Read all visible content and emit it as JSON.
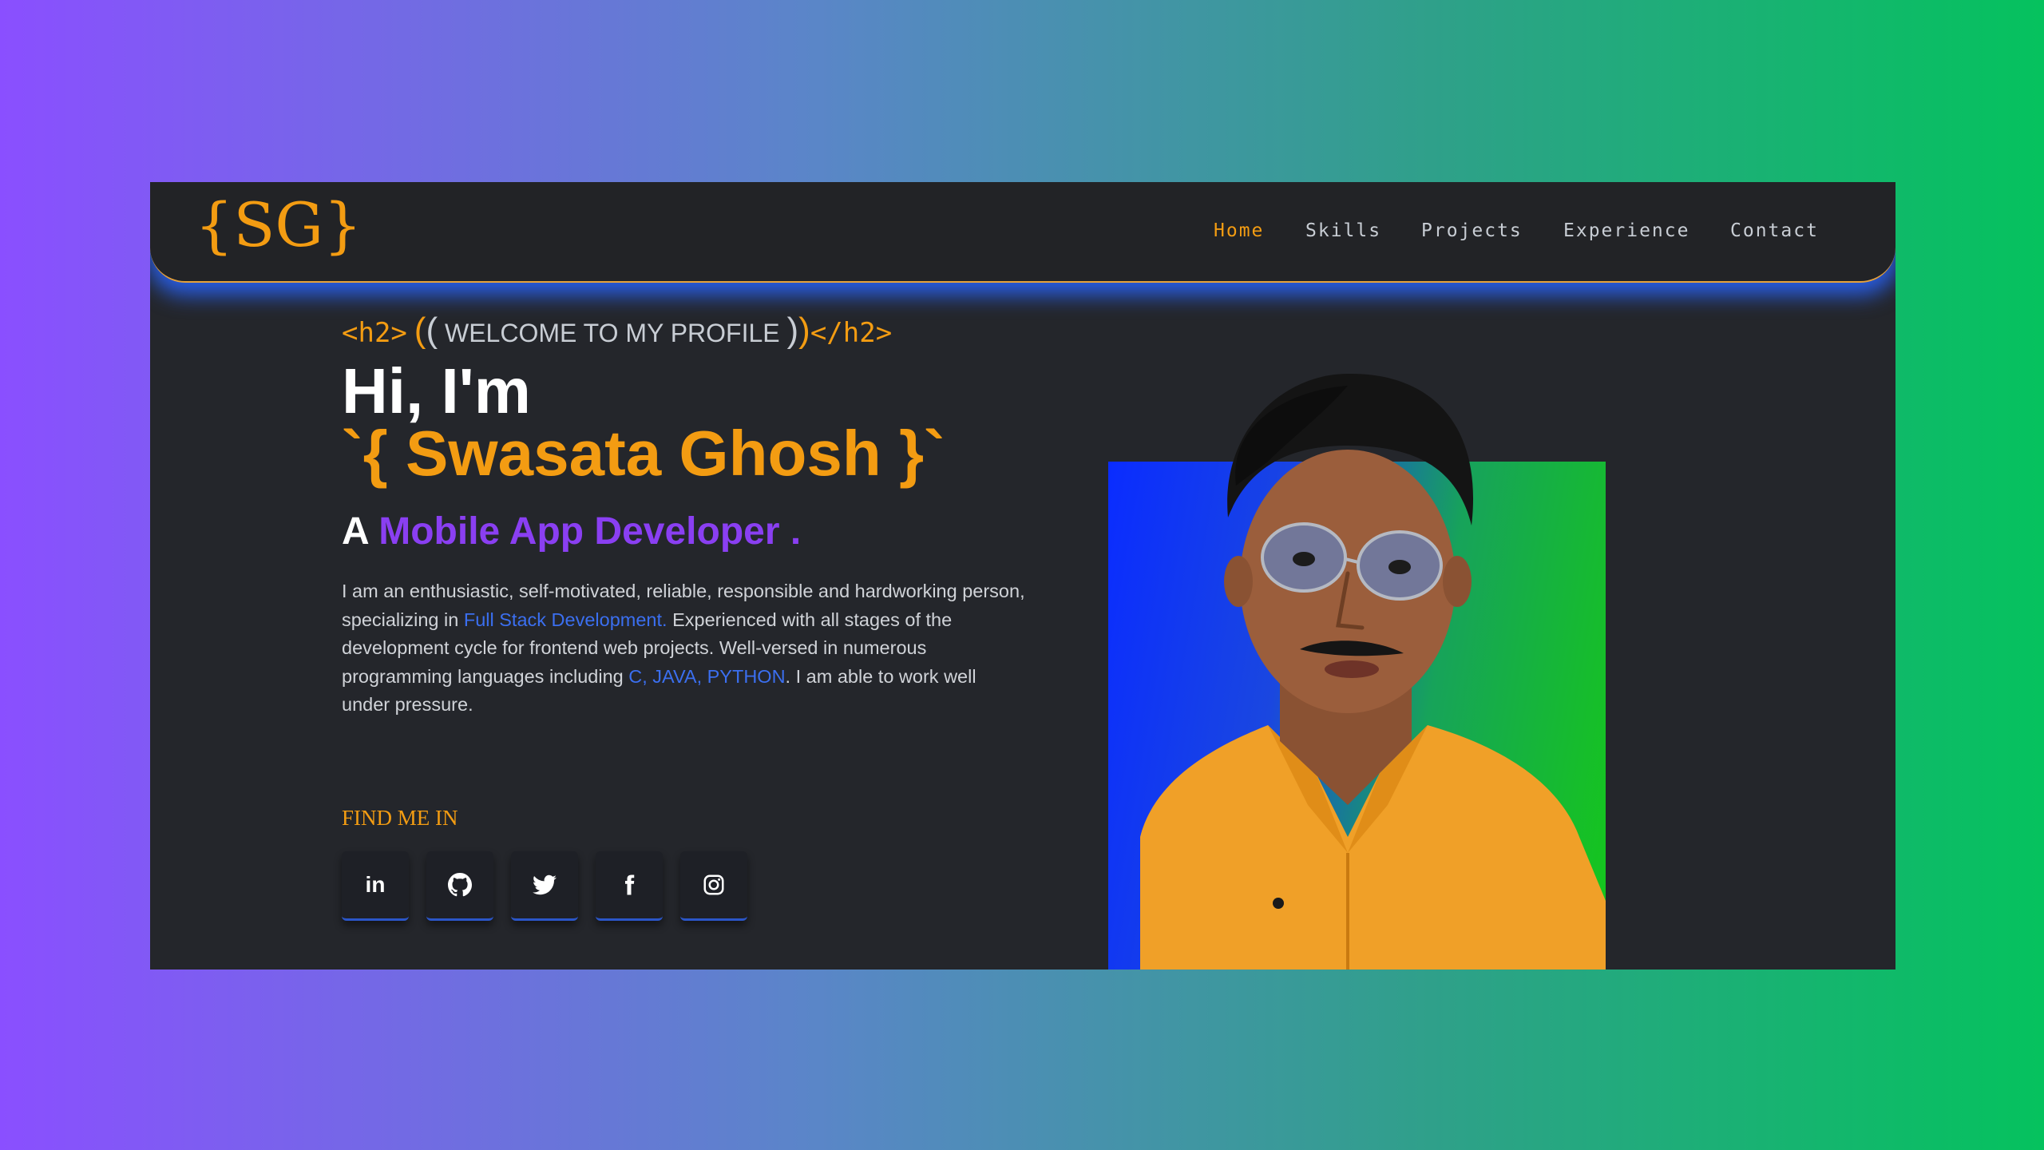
{
  "header": {
    "logo": "{SG}",
    "nav": [
      {
        "label": "Home",
        "active": true
      },
      {
        "label": "Skills",
        "active": false
      },
      {
        "label": "Projects",
        "active": false
      },
      {
        "label": "Experience",
        "active": false
      },
      {
        "label": "Contact",
        "active": false
      }
    ]
  },
  "hero": {
    "welcome_open_tag": "<h2>",
    "welcome_paren_open": "(",
    "welcome_paren_open_inner": "(",
    "welcome_text": "WELCOME TO MY PROFILE",
    "welcome_paren_close_inner": ")",
    "welcome_paren_close": ")",
    "welcome_close_tag": "</h2>",
    "greeting": "Hi, I'm",
    "name": "`{ Swasata Ghosh }`",
    "role_prefix": "A",
    "role": "Mobile App Developer .",
    "bio": {
      "part1": "I am an enthusiastic, self-motivated, reliable, responsible and hardworking person, specializing in ",
      "highlight1": "Full Stack Development.",
      "part2": " Experienced with all stages of the development cycle for frontend web projects. Well-versed in numerous programming languages including ",
      "highlight2": "C, JAVA, PYTHON",
      "part3": ". I am able to work well under pressure."
    },
    "find_me": "FIND ME IN",
    "socials": [
      {
        "icon": "linkedin-icon",
        "label": "in"
      },
      {
        "icon": "github-icon"
      },
      {
        "icon": "twitter-icon"
      },
      {
        "icon": "facebook-icon"
      },
      {
        "icon": "instagram-icon"
      }
    ]
  },
  "colors": {
    "accent": "#f39c12",
    "purple": "#8a3ff2",
    "link_blue": "#3b6ff0",
    "panel": "#24262b",
    "nav_glow": "#285feb"
  }
}
